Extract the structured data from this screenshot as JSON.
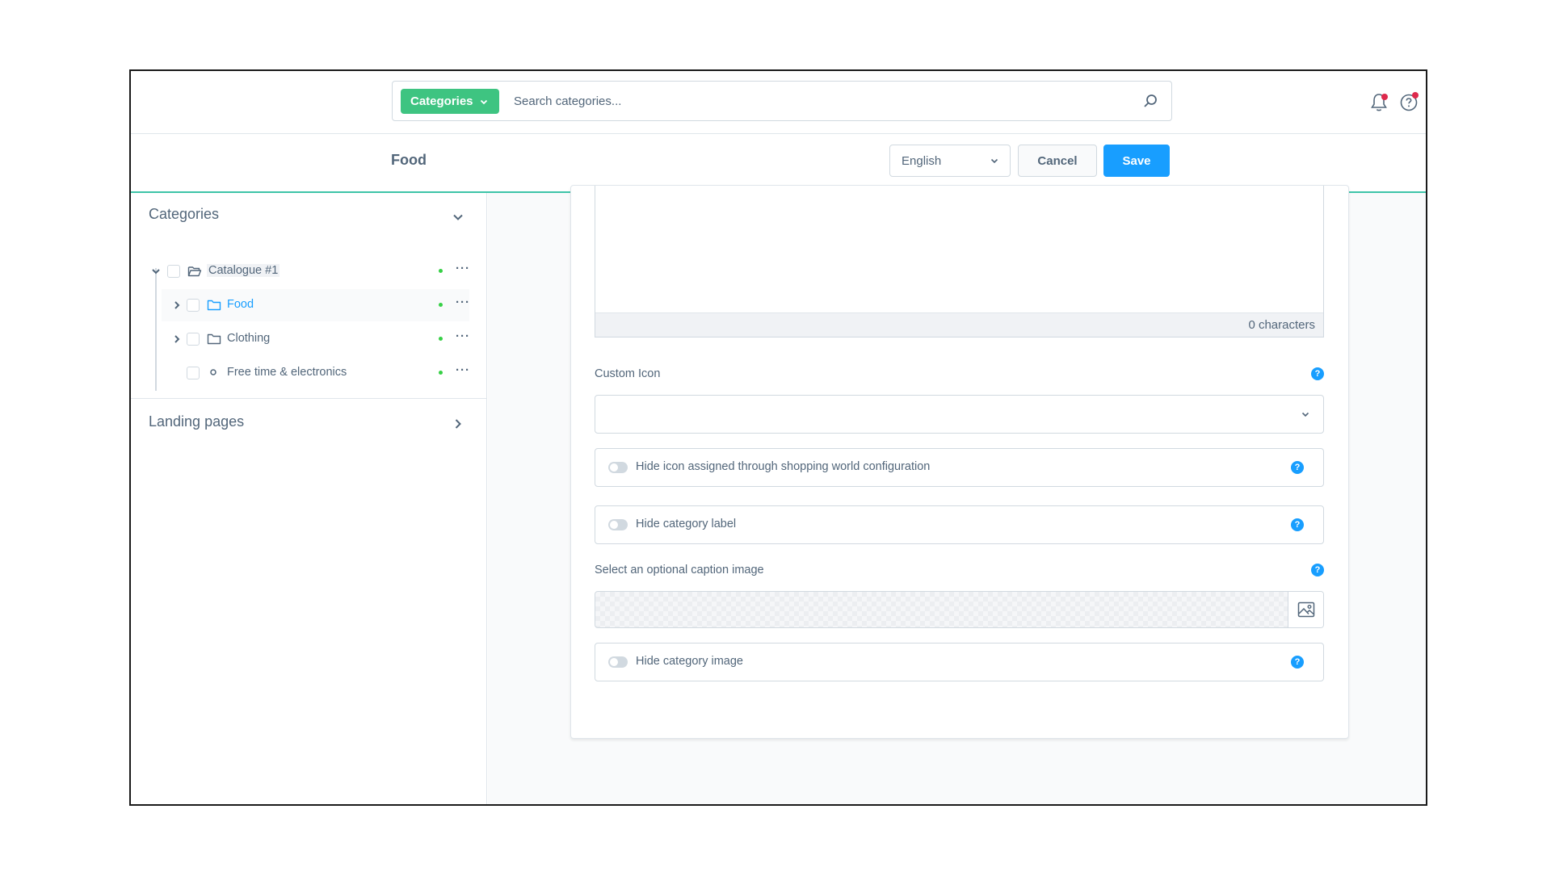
{
  "search": {
    "type_label": "Categories",
    "placeholder": "Search categories..."
  },
  "smartbar": {
    "title": "Food",
    "language": "English",
    "cancel_label": "Cancel",
    "save_label": "Save"
  },
  "sidebar": {
    "categories_title": "Categories",
    "landing_title": "Landing pages",
    "tree": [
      {
        "label": "Catalogue #1",
        "expanded": true,
        "active": false
      },
      {
        "label": "Food",
        "expanded": false,
        "active": true
      },
      {
        "label": "Clothing",
        "expanded": false,
        "active": false
      },
      {
        "label": "Free time & electronics",
        "expanded": false,
        "active": false
      }
    ],
    "more_label": "···"
  },
  "form": {
    "char_count": "0 characters",
    "custom_icon_label": "Custom Icon",
    "hide_icon_label": "Hide icon assigned through shopping world configuration",
    "hide_label_label": "Hide category label",
    "caption_image_label": "Select an optional caption image",
    "hide_image_label": "Hide category image",
    "help_symbol": "?"
  },
  "colors": {
    "primary": "#189eff",
    "success": "#37d046",
    "search_type": "#3ec481",
    "accent_line": "#3ec4a8",
    "notification": "#de294c"
  }
}
